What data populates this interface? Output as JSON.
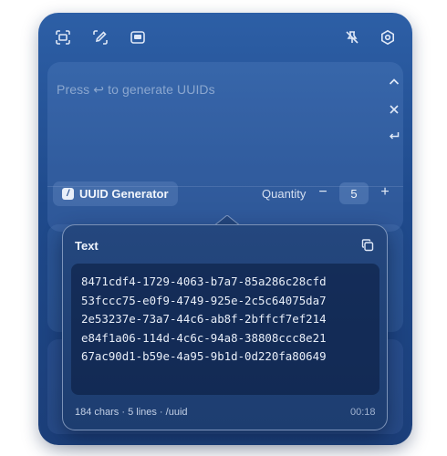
{
  "toolbar": {
    "icons": [
      "screenshot-icon",
      "color-picker-icon",
      "window-icon",
      "pin-off-icon",
      "settings-icon"
    ]
  },
  "editor": {
    "placeholder": "Press ↩ to generate UUIDs",
    "side_icons": [
      "chevron-up-icon",
      "close-icon",
      "return-icon"
    ]
  },
  "command": {
    "icon_glyph": "/",
    "label": "UUID Generator"
  },
  "quantity": {
    "label": "Quantity",
    "minus": "−",
    "value": "5",
    "plus": "+"
  },
  "result": {
    "title": "Text",
    "lines": [
      "8471cdf4-1729-4063-b7a7-85a286c28cfd",
      "53fccc75-e0f9-4749-925e-2c5c64075da7",
      "2e53237e-73a7-44c6-ab8f-2bffcf7ef214",
      "e84f1a06-114d-4c6c-94a8-38808ccc8e21",
      "67ac90d1-b59e-4a95-9b1d-0d220fa80649"
    ],
    "meta": "184 chars · 5 lines · /uuid",
    "time": "00:18"
  }
}
